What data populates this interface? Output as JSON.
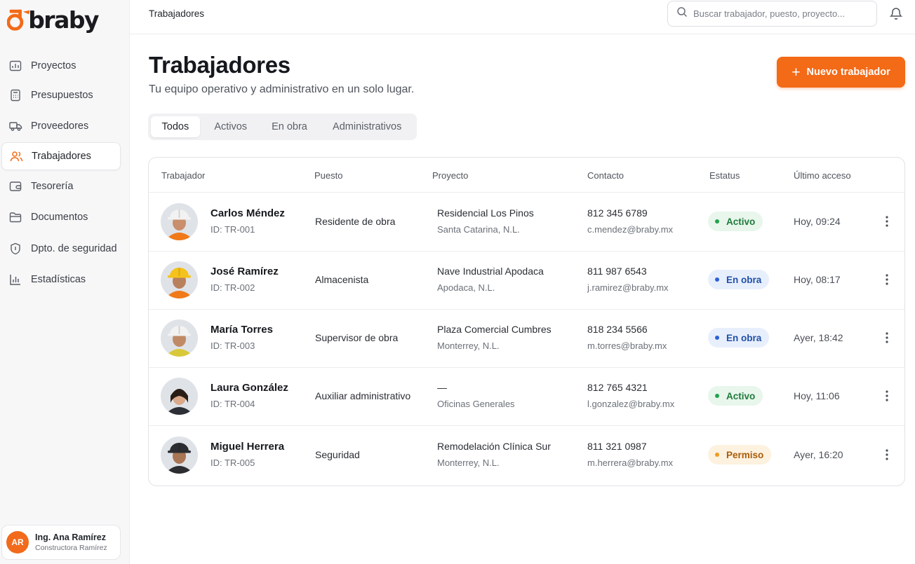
{
  "brand": {
    "name": "braby",
    "accent": "#f36a17"
  },
  "sidebar": {
    "items": [
      {
        "label": "Proyectos",
        "icon": "chart-bars-icon",
        "active": false
      },
      {
        "label": "Presupuestos",
        "icon": "calculator-icon",
        "active": false
      },
      {
        "label": "Proveedores",
        "icon": "truck-icon",
        "active": false
      },
      {
        "label": "Trabajadores",
        "icon": "users-icon",
        "active": true
      },
      {
        "label": "Tesorería",
        "icon": "wallet-icon",
        "active": false
      },
      {
        "label": "Documentos",
        "icon": "folder-icon",
        "active": false
      },
      {
        "label": "Dpto. de seguridad",
        "icon": "shield-icon",
        "active": false
      },
      {
        "label": "Estadísticas",
        "icon": "bar-chart-icon",
        "active": false
      }
    ],
    "user": {
      "initials": "AR",
      "name": "Ing. Ana Ramírez",
      "company": "Constructora Ramírez"
    }
  },
  "topbar": {
    "breadcrumb": "Trabajadores",
    "search_placeholder": "Buscar trabajador, puesto, proyecto..."
  },
  "header": {
    "title": "Trabajadores",
    "subtitle": "Tu equipo operativo y administrativo en un solo lugar.",
    "new_button": "Nuevo trabajador"
  },
  "tabs": [
    {
      "label": "Todos",
      "active": true
    },
    {
      "label": "Activos",
      "active": false
    },
    {
      "label": "En obra",
      "active": false
    },
    {
      "label": "Administrativos",
      "active": false
    }
  ],
  "table": {
    "columns": [
      "Trabajador",
      "Puesto",
      "Proyecto",
      "Contacto",
      "Estatus",
      "Último acceso"
    ],
    "rows": [
      {
        "name": "Carlos Méndez",
        "id": "ID: TR-001",
        "puesto": "Residente de obra",
        "proyecto": "Residencial Los Pinos",
        "ubicacion": "Santa Catarina, N.L.",
        "telefono": "812 345 6789",
        "email": "c.mendez@braby.mx",
        "estatus": "Activo",
        "acceso": "Hoy, 09:24",
        "helmet": "#f2f2f2",
        "vest": "#f07a1a",
        "skin": "#c98e6c"
      },
      {
        "name": "José Ramírez",
        "id": "ID: TR-002",
        "puesto": "Almacenista",
        "proyecto": "Nave Industrial Apodaca",
        "ubicacion": "Apodaca, N.L.",
        "telefono": "811 987 6543",
        "email": "j.ramirez@braby.mx",
        "estatus": "En obra",
        "acceso": "Hoy, 08:17",
        "helmet": "#f5c21b",
        "vest": "#f07a1a",
        "skin": "#b9805d"
      },
      {
        "name": "María Torres",
        "id": "ID: TR-003",
        "puesto": "Supervisor de obra",
        "proyecto": "Plaza Comercial Cumbres",
        "ubicacion": "Monterrey, N.L.",
        "telefono": "818 234 5566",
        "email": "m.torres@braby.mx",
        "estatus": "En obra",
        "acceso": "Ayer, 18:42",
        "helmet": "#f2f2f2",
        "vest": "#d9c93a",
        "skin": "#c08a66"
      },
      {
        "name": "Laura González",
        "id": "ID: TR-004",
        "puesto": "Auxiliar administrativo",
        "proyecto": "—",
        "ubicacion": "Oficinas Generales",
        "telefono": "812 765 4321",
        "email": "l.gonzalez@braby.mx",
        "estatus": "Activo",
        "acceso": "Hoy, 11:06",
        "helmet": "",
        "vest": "#2d2f36",
        "skin": "#d9a98a"
      },
      {
        "name": "Miguel Herrera",
        "id": "ID: TR-005",
        "puesto": "Seguridad",
        "proyecto": "Remodelación Clínica Sur",
        "ubicacion": "Monterrey, N.L.",
        "telefono": "811 321 0987",
        "email": "m.herrera@braby.mx",
        "estatus": "Permiso",
        "acceso": "Ayer, 16:20",
        "helmet": "#2b2d31",
        "vest": "#2b2d31",
        "skin": "#a87555"
      }
    ]
  },
  "status_styles": {
    "Activo": {
      "bg": "#e8f6ec",
      "fg": "#1f7a3b",
      "dot": "#22a34a"
    },
    "En obra": {
      "bg": "#e8effc",
      "fg": "#1f4fa8",
      "dot": "#2a62d6"
    },
    "Permiso": {
      "bg": "#fdf1df",
      "fg": "#a75c0c",
      "dot": "#f09a1f"
    }
  }
}
